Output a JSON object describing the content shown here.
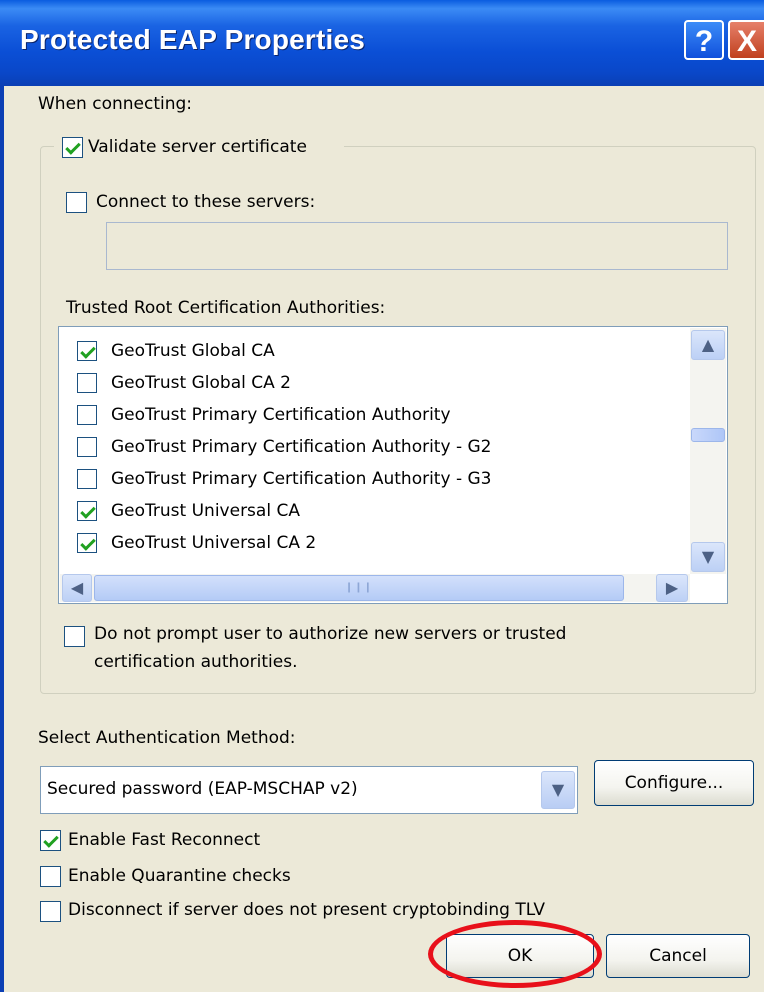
{
  "window": {
    "title": "Protected EAP Properties",
    "help_icon": "?",
    "close_icon": "X"
  },
  "section_label": "When connecting:",
  "validate": {
    "label": "Validate server certificate",
    "checked": true
  },
  "connect_servers": {
    "label": "Connect to these servers:",
    "checked": false,
    "value": ""
  },
  "trusted_label": "Trusted Root Certification Authorities:",
  "ca_list": [
    {
      "label": "GeoTrust Global CA",
      "checked": true
    },
    {
      "label": "GeoTrust Global CA 2",
      "checked": false
    },
    {
      "label": "GeoTrust Primary Certification Authority",
      "checked": false
    },
    {
      "label": "GeoTrust Primary Certification Authority - G2",
      "checked": false
    },
    {
      "label": "GeoTrust Primary Certification Authority - G3",
      "checked": false
    },
    {
      "label": "GeoTrust Universal CA",
      "checked": true
    },
    {
      "label": "GeoTrust Universal CA 2",
      "checked": true
    }
  ],
  "do_not_prompt": {
    "line1": "Do not prompt user to authorize new servers or trusted",
    "line2": "certification authorities.",
    "checked": false
  },
  "auth_method_label": "Select Authentication Method:",
  "auth_method_value": "Secured password (EAP-MSCHAP v2)",
  "configure_label": "Configure...",
  "options": [
    {
      "label": "Enable Fast Reconnect",
      "checked": true
    },
    {
      "label": "Enable Quarantine checks",
      "checked": false
    },
    {
      "label": "Disconnect if server does not present cryptobinding TLV",
      "checked": false
    }
  ],
  "ok_label": "OK",
  "cancel_label": "Cancel",
  "colors": {
    "title_bar": "#0a47c8",
    "dialog_bg": "#ece9d8",
    "highlight_ring": "#e8101a",
    "check": "#21a121"
  }
}
